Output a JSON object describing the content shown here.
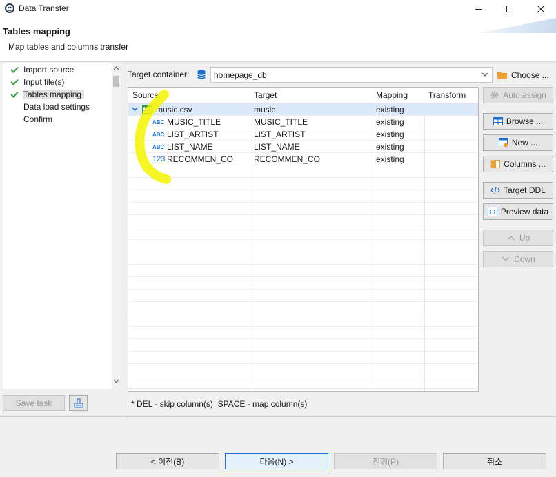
{
  "window": {
    "title": "Data Transfer"
  },
  "header": {
    "title": "Tables mapping",
    "subtitle": "Map tables and columns transfer"
  },
  "nav": {
    "items": [
      {
        "label": "Import source",
        "done": true
      },
      {
        "label": "Input file(s)",
        "done": true
      },
      {
        "label": "Tables mapping",
        "done": true,
        "active": true
      },
      {
        "label": "Data load settings",
        "done": false
      },
      {
        "label": "Confirm",
        "done": false
      }
    ]
  },
  "bottom_left": {
    "save_task": "Save task"
  },
  "target_container": {
    "label": "Target container:",
    "value": "homepage_db",
    "choose": "Choose ..."
  },
  "table": {
    "columns": [
      "Source",
      "Target",
      "Mapping",
      "Transform"
    ],
    "rows": [
      {
        "icon": "table-icon",
        "source": "music.csv",
        "target": "music",
        "mapping": "existing",
        "transform": ""
      },
      {
        "icon": "abc",
        "source": "MUSIC_TITLE",
        "target": "MUSIC_TITLE",
        "mapping": "existing",
        "transform": ""
      },
      {
        "icon": "abc",
        "source": "LIST_ARTIST",
        "target": "LIST_ARTIST",
        "mapping": "existing",
        "transform": ""
      },
      {
        "icon": "abc",
        "source": "LIST_NAME",
        "target": "LIST_NAME",
        "mapping": "existing",
        "transform": ""
      },
      {
        "icon": "123",
        "source": "RECOMMEN_CO",
        "target": "RECOMMEN_CO",
        "mapping": "existing",
        "transform": ""
      }
    ]
  },
  "actions": {
    "auto_assign": "Auto assign",
    "browse": "Browse ...",
    "new": "New ...",
    "columns": "Columns ...",
    "target_ddl": "Target DDL",
    "preview_data": "Preview data",
    "up": "Up",
    "down": "Down"
  },
  "hint": "* DEL - skip column(s)  SPACE - map column(s)",
  "footer": {
    "back": "< 이전(B)",
    "next": "다음(N) >",
    "proceed": "진행(P)",
    "cancel": "취소"
  },
  "colors": {
    "accent": "#1e6fd9",
    "check": "#2e9e3a",
    "selection": "#dbe9fb",
    "highlighter": "#f5f500"
  }
}
